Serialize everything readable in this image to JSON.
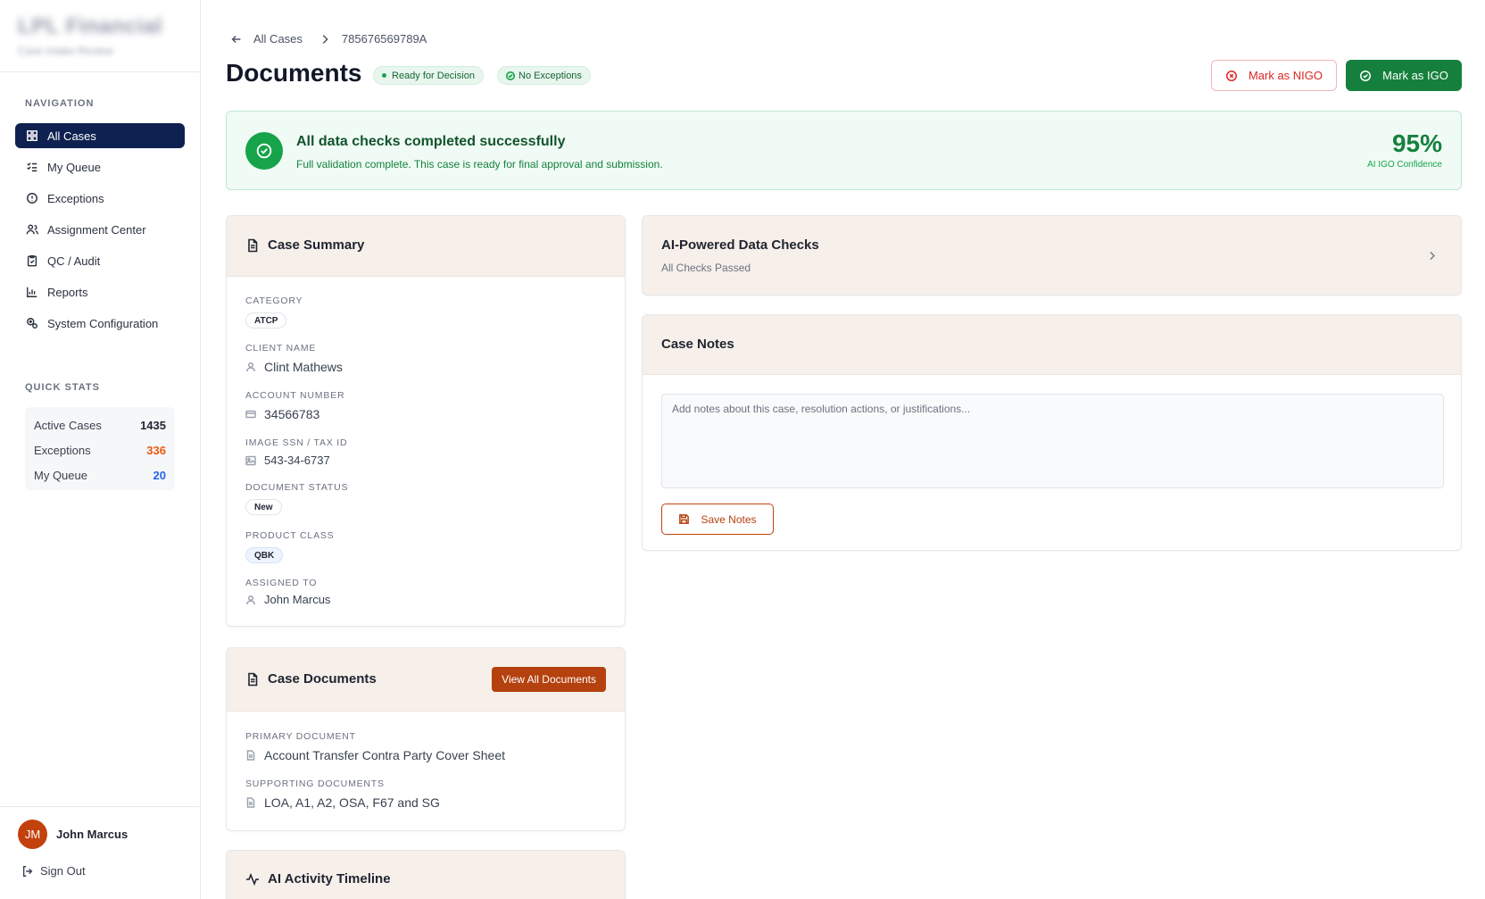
{
  "brand": {
    "name": "LPL Financial",
    "subtitle": "Case Intake Review"
  },
  "sidebar": {
    "navigation_title": "NAVIGATION",
    "items": [
      {
        "label": "All Cases",
        "icon": "grid-icon",
        "active": true
      },
      {
        "label": "My Queue",
        "icon": "list-check-icon",
        "active": false
      },
      {
        "label": "Exceptions",
        "icon": "alert-circle-icon",
        "active": false
      },
      {
        "label": "Assignment Center",
        "icon": "users-icon",
        "active": false
      },
      {
        "label": "QC / Audit",
        "icon": "clipboard-check-icon",
        "active": false
      },
      {
        "label": "Reports",
        "icon": "bar-chart-icon",
        "active": false
      },
      {
        "label": "System Configuration",
        "icon": "settings-icon",
        "active": false
      }
    ],
    "quick_stats_title": "QUICK STATS",
    "stats": [
      {
        "label": "Active Cases",
        "value": "1435",
        "color": "#1f2430"
      },
      {
        "label": "Exceptions",
        "value": "336",
        "color": "#ea580c"
      },
      {
        "label": "My Queue",
        "value": "20",
        "color": "#2563eb"
      }
    ],
    "user": {
      "initials": "JM",
      "name": "John Marcus"
    },
    "sign_out": "Sign Out"
  },
  "header": {
    "breadcrumb_root": "All Cases",
    "breadcrumb_current": "785676569789A",
    "title": "Documents",
    "badge_ready": "Ready for Decision",
    "badge_exceptions": "No Exceptions",
    "nigo_label": "Mark as NIGO",
    "igo_label": "Mark as IGO"
  },
  "banner": {
    "title": "All data checks completed successfully",
    "subtitle": "Full validation complete. This case is ready for final approval and submission.",
    "confidence": "95%",
    "confidence_label": "AI IGO Confidence"
  },
  "case_summary": {
    "title": "Case Summary",
    "category_label": "CATEGORY",
    "category": "ATCP",
    "client_name_label": "CLIENT NAME",
    "client_name": "Clint Mathews",
    "account_number_label": "ACCOUNT NUMBER",
    "account_number": "34566783",
    "ssn_label": "IMAGE SSN / TAX ID",
    "ssn": "543-34-6737",
    "doc_status_label": "DOCUMENT STATUS",
    "doc_status": "New",
    "product_class_label": "PRODUCT CLASS",
    "product_class": "QBK",
    "assigned_to_label": "ASSIGNED TO",
    "assigned_to": "John Marcus"
  },
  "case_documents": {
    "title": "Case Documents",
    "view_all_label": "View All Documents",
    "primary_label": "PRIMARY DOCUMENT",
    "primary": "Account Transfer Contra Party Cover Sheet",
    "supporting_label": "SUPPORTING DOCUMENTS",
    "supporting": "LOA, A1, A2, OSA, F67 and SG"
  },
  "timeline": {
    "title": "AI Activity Timeline"
  },
  "data_checks": {
    "title": "AI-Powered Data Checks",
    "subtitle": "All Checks Passed"
  },
  "case_notes": {
    "title": "Case Notes",
    "placeholder": "Add notes about this case, resolution actions, or justifications...",
    "value": "",
    "save_label": "Save Notes"
  },
  "colors": {
    "navy": "#0f2150",
    "green": "#15803d",
    "orange": "#b5410e",
    "red": "#dc2626"
  }
}
